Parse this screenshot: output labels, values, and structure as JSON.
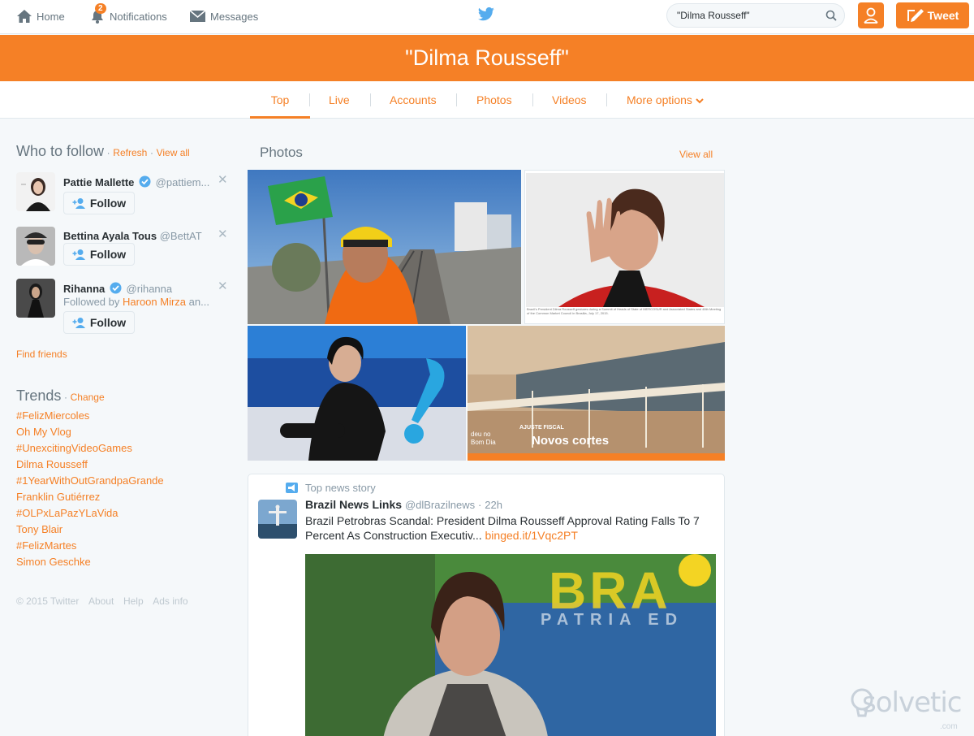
{
  "nav": {
    "home_label": "Home",
    "notifications_label": "Notifications",
    "notifications_count": "2",
    "messages_label": "Messages",
    "search_value": "\"Dilma Rousseff\"",
    "tweet_label": "Tweet"
  },
  "hero": {
    "title": "\"Dilma Rousseff\""
  },
  "tabs": [
    {
      "label": "Top"
    },
    {
      "label": "Live"
    },
    {
      "label": "Accounts"
    },
    {
      "label": "Photos"
    },
    {
      "label": "Videos"
    },
    {
      "label": "More options"
    }
  ],
  "who_to_follow": {
    "title": "Who to follow",
    "refresh": "Refresh",
    "view_all": "View all",
    "follow_label": "Follow",
    "users": [
      {
        "name": "Pattie Mallette",
        "handle": "@pattiem..."
      },
      {
        "name": "Bettina Ayala Tous",
        "handle": "@BettAT"
      },
      {
        "name": "Rihanna",
        "handle": "@rihanna",
        "followed_by_prefix": "Followed by",
        "followed_by_name": "Haroon Mirza",
        "followed_by_suffix": "an..."
      }
    ],
    "find_friends": "Find friends"
  },
  "trends": {
    "title": "Trends",
    "change": "Change",
    "items": [
      "#FelizMiercoles",
      "Oh My Vlog",
      "#UnexcitingVideoGames",
      "Dilma Rousseff",
      "#1YearWithOutGrandpaGrande",
      "Franklin Gutiérrez",
      "#OLPxLaPazYLaVida",
      "Tony Blair",
      "#FelizMartes",
      "Simon Geschke"
    ]
  },
  "footer": {
    "copyright": "© 2015 Twitter",
    "about": "About",
    "help": "Help",
    "ads": "Ads info"
  },
  "photos": {
    "title": "Photos",
    "view_all": "View all",
    "overlay_small": "deu no Bom Dia",
    "overlay_tag": "AJUSTE FISCAL",
    "overlay_title": "Novos cortes",
    "caption": "Brazil's President Dilma Rousseff gestures during a Summit of Heads of State of MERCOSUR and Associated States and 48th Meeting of the Common Market Council in Brasilia, July 17, 2015."
  },
  "top_story": {
    "label": "Top news story",
    "author": "Brazil News Links",
    "handle": "@dlBrazilnews",
    "time": "22h",
    "text": "Brazil Petrobras Scandal: President Dilma Rousseff Approval Rating Falls To 7 Percent As Construction Executiv...",
    "link": "binged.it/1Vqc2PT",
    "image_text": "BRA",
    "image_subtext": "PATRIA ED"
  },
  "watermark": {
    "main": "solvetic",
    "sub": ".com"
  },
  "colors": {
    "accent": "#f58026",
    "background": "#f5f8fa",
    "link_blue": "#55acee"
  }
}
